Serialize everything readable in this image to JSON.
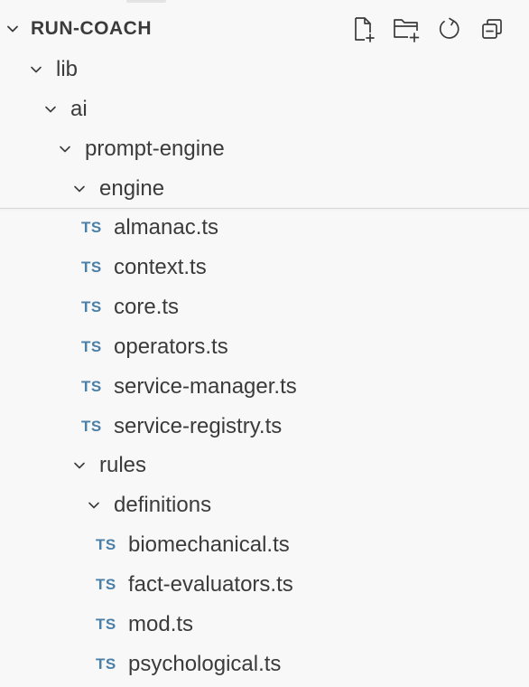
{
  "explorer": {
    "section_title": "RUN-COACH",
    "actions": [
      {
        "name": "new-file-icon"
      },
      {
        "name": "new-folder-icon"
      },
      {
        "name": "refresh-icon"
      },
      {
        "name": "collapse-all-icon"
      }
    ]
  },
  "tree": {
    "folders": {
      "lib": "lib",
      "ai": "ai",
      "prompt_engine": "prompt-engine",
      "engine": "engine",
      "rules": "rules",
      "definitions": "definitions"
    },
    "engine_files": [
      "almanac.ts",
      "context.ts",
      "core.ts",
      "operators.ts",
      "service-manager.ts",
      "service-registry.ts"
    ],
    "definitions_files": [
      "biomechanical.ts",
      "fact-evaluators.ts",
      "mod.ts",
      "psychological.ts"
    ],
    "file_icon_text": "TS"
  },
  "colors": {
    "background": "#f8f8f8",
    "text": "#3b3b3b",
    "ts_icon": "#4a7fa8"
  }
}
